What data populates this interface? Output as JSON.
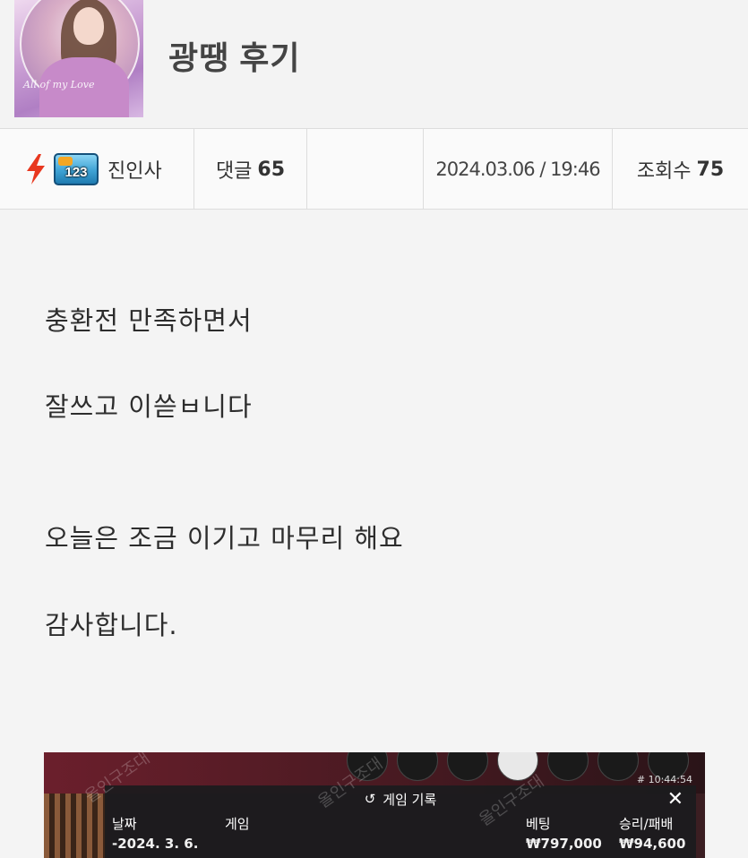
{
  "post": {
    "title": "광땡 후기",
    "author": "진인사",
    "level": "123",
    "comments_label": "댓글",
    "comments_count": "65",
    "datetime": "2024.03.06 / 19:46",
    "views_label": "조회수",
    "views_count": "75"
  },
  "thumbnail": {
    "script_text": "All of my Love"
  },
  "body": {
    "lines": [
      "충환전 만족하면서",
      "잘쓰고 이쓷ㅂ니다",
      "오늘은 조금 이기고 마무리 해요",
      "감사합니다."
    ]
  },
  "screenshot": {
    "time": "# 10:44:54",
    "modal_title": "게임 기록",
    "close": "✕",
    "history_icon": "history-icon",
    "columns": [
      "날짜",
      "게임",
      "베팅",
      "승리/패배"
    ],
    "row": [
      "-2024. 3. 6.",
      "",
      "₩797,000",
      "₩94,600"
    ],
    "watermark": "올인구조대"
  },
  "colors": {
    "bolt": "#e8381f",
    "title": "#444444",
    "border": "#dddddd"
  }
}
